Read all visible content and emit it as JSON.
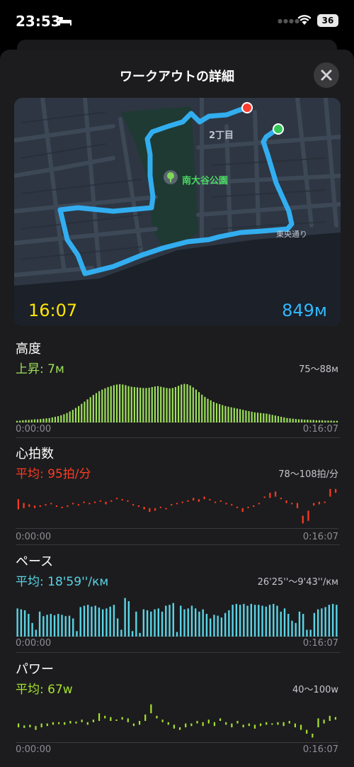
{
  "status_bar": {
    "time": "23:53",
    "battery": "36"
  },
  "header": {
    "title": "ワークアウトの詳細"
  },
  "map": {
    "elapsed_time": "16:07",
    "distance": "849м",
    "park_label": "南大谷公園",
    "block_label": "2丁目",
    "street_label": "東央通り"
  },
  "sections": {
    "elevation": {
      "title": "高度",
      "value": "上昇: 7м",
      "range": "75〜88м",
      "start": "0:00:00",
      "end": "0:16:07",
      "color": "#9ee05a"
    },
    "heart": {
      "title": "心拍数",
      "value": "平均: 95拍/分",
      "range": "78〜108拍/分",
      "start": "0:00:00",
      "end": "0:16:07",
      "color": "#ff3b22"
    },
    "pace": {
      "title": "ペース",
      "value": "平均: 18'59''/км",
      "range": "26'25''〜9'43''/км",
      "start": "0:00:00",
      "end": "0:16:07",
      "color": "#5ad4e6"
    },
    "power": {
      "title": "パワー",
      "value": "平均: 67w",
      "range": "40〜100w",
      "start": "0:00:00",
      "end": "0:16:07",
      "color": "#a6e22e"
    }
  },
  "chart_data": [
    {
      "type": "bar",
      "title": "高度",
      "unit": "м",
      "ylim": [
        75,
        88
      ],
      "values": [
        75.5,
        75.6,
        75.7,
        75.8,
        75.8,
        75.9,
        76,
        76,
        76.1,
        76.2,
        76.3,
        76.4,
        76.6,
        76.8,
        77,
        77.3,
        77.6,
        78,
        78.5,
        79,
        79.6,
        80.2,
        80.9,
        81.6,
        82.3,
        83,
        83.7,
        84.3,
        84.9,
        85.4,
        85.8,
        86.2,
        86.5,
        86.8,
        87,
        87.1,
        87,
        86.8,
        86.5,
        86.3,
        86.2,
        86.1,
        86,
        85.9,
        85.9,
        86,
        86.2,
        86.4,
        86.5,
        86.3,
        86.1,
        85.9,
        85.8,
        85.9,
        86.2,
        86.6,
        87,
        87.2,
        87.1,
        86.7,
        86.1,
        85.4,
        84.6,
        83.8,
        83.1,
        82.5,
        82,
        81.5,
        81.1,
        80.8,
        80.5,
        80.2,
        80,
        79.8,
        79.6,
        79.4,
        79.2,
        79,
        78.8,
        78.6,
        78.4,
        78.2,
        78.1,
        78,
        77.9,
        77.8,
        77.6,
        77.4,
        77.2,
        77,
        76.8,
        76.6,
        76.4,
        76.3,
        76.2,
        76.1,
        76,
        76,
        75.9,
        75.9,
        75.8,
        75.8,
        75.7,
        75.7,
        75.7,
        75.6,
        75.6,
        75.6,
        75.5,
        75.5
      ]
    },
    {
      "type": "range",
      "title": "心拍数",
      "unit": "拍/分",
      "ylim": [
        78,
        108
      ],
      "values": [
        [
          91,
          99
        ],
        [
          92,
          96
        ],
        [
          93,
          95
        ],
        [
          92,
          94
        ],
        [
          93,
          94
        ],
        [
          94,
          95
        ],
        [
          95,
          96
        ],
        [
          93,
          94
        ],
        [
          92,
          93
        ],
        [
          93,
          94
        ],
        [
          95,
          96
        ],
        [
          94,
          95
        ],
        [
          96,
          97
        ],
        [
          95,
          96
        ],
        [
          96,
          97
        ],
        [
          97,
          98
        ],
        [
          95,
          97
        ],
        [
          97,
          98
        ],
        [
          99,
          100
        ],
        [
          98,
          99
        ],
        [
          97,
          98
        ],
        [
          94,
          95
        ],
        [
          93,
          94
        ],
        [
          91,
          93
        ],
        [
          89,
          92
        ],
        [
          90,
          92
        ],
        [
          92,
          93
        ],
        [
          91,
          92
        ],
        [
          94,
          95
        ],
        [
          95,
          96
        ],
        [
          96,
          97
        ],
        [
          97,
          98
        ],
        [
          98,
          100
        ],
        [
          97,
          99
        ],
        [
          99,
          101
        ],
        [
          98,
          99
        ],
        [
          96,
          97
        ],
        [
          97,
          98
        ],
        [
          95,
          96
        ],
        [
          94,
          95
        ],
        [
          92,
          93
        ],
        [
          89,
          92
        ],
        [
          92,
          93
        ],
        [
          93,
          94
        ],
        [
          95,
          96
        ],
        [
          100,
          101
        ],
        [
          100,
          104
        ],
        [
          101,
          105
        ],
        [
          99,
          100
        ],
        [
          96,
          98
        ],
        [
          95,
          96
        ],
        [
          92,
          96
        ],
        [
          80,
          86
        ],
        [
          82,
          90
        ],
        [
          94,
          96
        ],
        [
          95,
          97
        ],
        [
          96,
          97
        ],
        [
          101,
          107
        ],
        [
          104,
          107
        ]
      ]
    },
    {
      "type": "bar",
      "title": "ペース",
      "unit": "/км",
      "ylim": [
        "26'25''",
        "9'43''"
      ],
      "values": [
        0.62,
        0.6,
        0.58,
        0.5,
        0.3,
        0.15,
        0.55,
        0.45,
        0.48,
        0.5,
        0.47,
        0.5,
        0.48,
        0.45,
        0.46,
        0.4,
        0.12,
        0.65,
        0.68,
        0.7,
        0.66,
        0.68,
        0.64,
        0.6,
        0.62,
        0.66,
        0.7,
        0.4,
        0.15,
        0.85,
        0.78,
        0.12,
        0.55,
        0.08,
        0.6,
        0.58,
        0.55,
        0.6,
        0.62,
        0.55,
        0.68,
        0.7,
        0.74,
        0.1,
        0.68,
        0.6,
        0.62,
        0.68,
        0.62,
        0.55,
        0.6,
        0.5,
        0.4,
        0.48,
        0.46,
        0.42,
        0.52,
        0.58,
        0.7,
        0.72,
        0.7,
        0.72,
        0.68,
        0.72,
        0.7,
        0.7,
        0.68,
        0.66,
        0.7,
        0.72,
        0.68,
        0.55,
        0.62,
        0.5,
        0.35,
        0.3,
        0.55,
        0.5,
        0.15,
        0.15,
        0.52,
        0.6,
        0.62,
        0.65,
        0.7,
        0.72,
        0.7
      ]
    },
    {
      "type": "range",
      "title": "パワー",
      "unit": "w",
      "ylim": [
        40,
        100
      ],
      "values": [
        [
          60,
          66
        ],
        [
          59,
          63
        ],
        [
          60,
          64
        ],
        [
          56,
          62
        ],
        [
          60,
          66
        ],
        [
          62,
          66
        ],
        [
          64,
          68
        ],
        [
          65,
          68
        ],
        [
          64,
          68
        ],
        [
          66,
          70
        ],
        [
          66,
          69
        ],
        [
          68,
          72
        ],
        [
          64,
          68
        ],
        [
          68,
          72
        ],
        [
          70,
          82
        ],
        [
          74,
          78
        ],
        [
          70,
          76
        ],
        [
          70,
          72
        ],
        [
          72,
          76
        ],
        [
          68,
          74
        ],
        [
          62,
          66
        ],
        [
          64,
          70
        ],
        [
          70,
          80
        ],
        [
          82,
          96
        ],
        [
          74,
          78
        ],
        [
          68,
          72
        ],
        [
          64,
          68
        ],
        [
          58,
          64
        ],
        [
          56,
          60
        ],
        [
          60,
          66
        ],
        [
          62,
          66
        ],
        [
          66,
          70
        ],
        [
          62,
          68
        ],
        [
          66,
          72
        ],
        [
          62,
          68
        ],
        [
          70,
          74
        ],
        [
          64,
          68
        ],
        [
          60,
          66
        ],
        [
          66,
          70
        ],
        [
          60,
          64
        ],
        [
          62,
          66
        ],
        [
          58,
          64
        ],
        [
          62,
          66
        ],
        [
          64,
          68
        ],
        [
          64,
          66
        ],
        [
          64,
          68
        ],
        [
          62,
          68
        ],
        [
          66,
          70
        ],
        [
          60,
          66
        ],
        [
          56,
          64
        ],
        [
          50,
          56
        ],
        [
          44,
          50
        ],
        [
          60,
          74
        ],
        [
          66,
          72
        ],
        [
          70,
          78
        ],
        [
          72,
          76
        ]
      ]
    }
  ]
}
